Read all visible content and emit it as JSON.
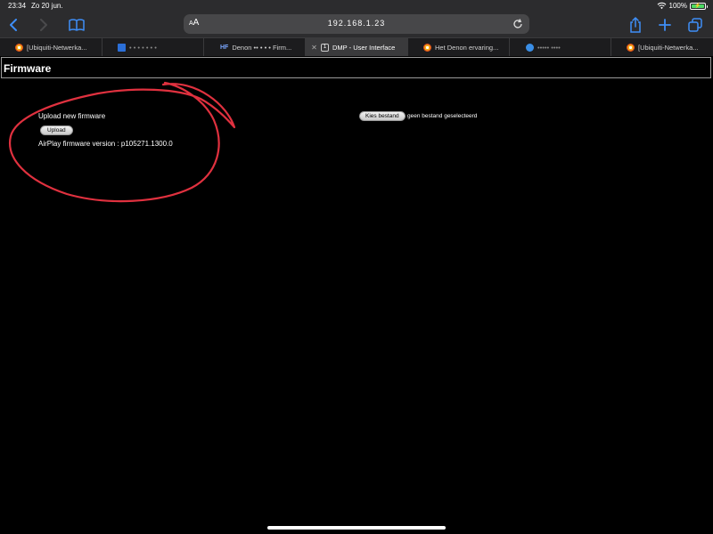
{
  "status_bar": {
    "time": "23:34",
    "date": "Zo 20 jun.",
    "battery_percent": "100%",
    "battery_level": 1.0
  },
  "toolbar": {
    "text_size_label_small": "A",
    "text_size_label_large": "A",
    "url": "192.168.1.23",
    "icons": [
      "chevron-left-icon",
      "chevron-right-icon",
      "book-icon",
      "reload-icon",
      "share-icon",
      "plus-icon",
      "tabs-icon"
    ]
  },
  "tabs": [
    {
      "title": "[Ubiquiti-Netwerka...",
      "icon": "ubiquiti-favicon",
      "active": false
    },
    {
      "title": "• • • • • • •",
      "icon": "blue-square-favicon",
      "active": false
    },
    {
      "title": "Denon •• • • • Firm...",
      "icon": "hf-favicon",
      "active": false
    },
    {
      "title": "DMP - User Interface",
      "icon": "page-favicon",
      "active": true
    },
    {
      "title": "Het Denon ervaring...",
      "icon": "ubiquiti-favicon",
      "active": false
    },
    {
      "title": "••••• ••••",
      "icon": "globe-favicon",
      "active": false
    },
    {
      "title": "[Ubiquiti-Netwerka...",
      "icon": "ubiquiti-favicon",
      "active": false
    }
  ],
  "page": {
    "title": "Firmware",
    "upload_label": "Upload new firmware",
    "upload_button": "Upload",
    "version_line": "AirPlay firmware version : p105271.1300.0",
    "choose_file_button": "Kies bestand",
    "no_file_text": "geen bestand geselecteerd"
  },
  "colors": {
    "annotation": "#e0313f",
    "accent": "#3e8ef7",
    "background": "#000000"
  }
}
